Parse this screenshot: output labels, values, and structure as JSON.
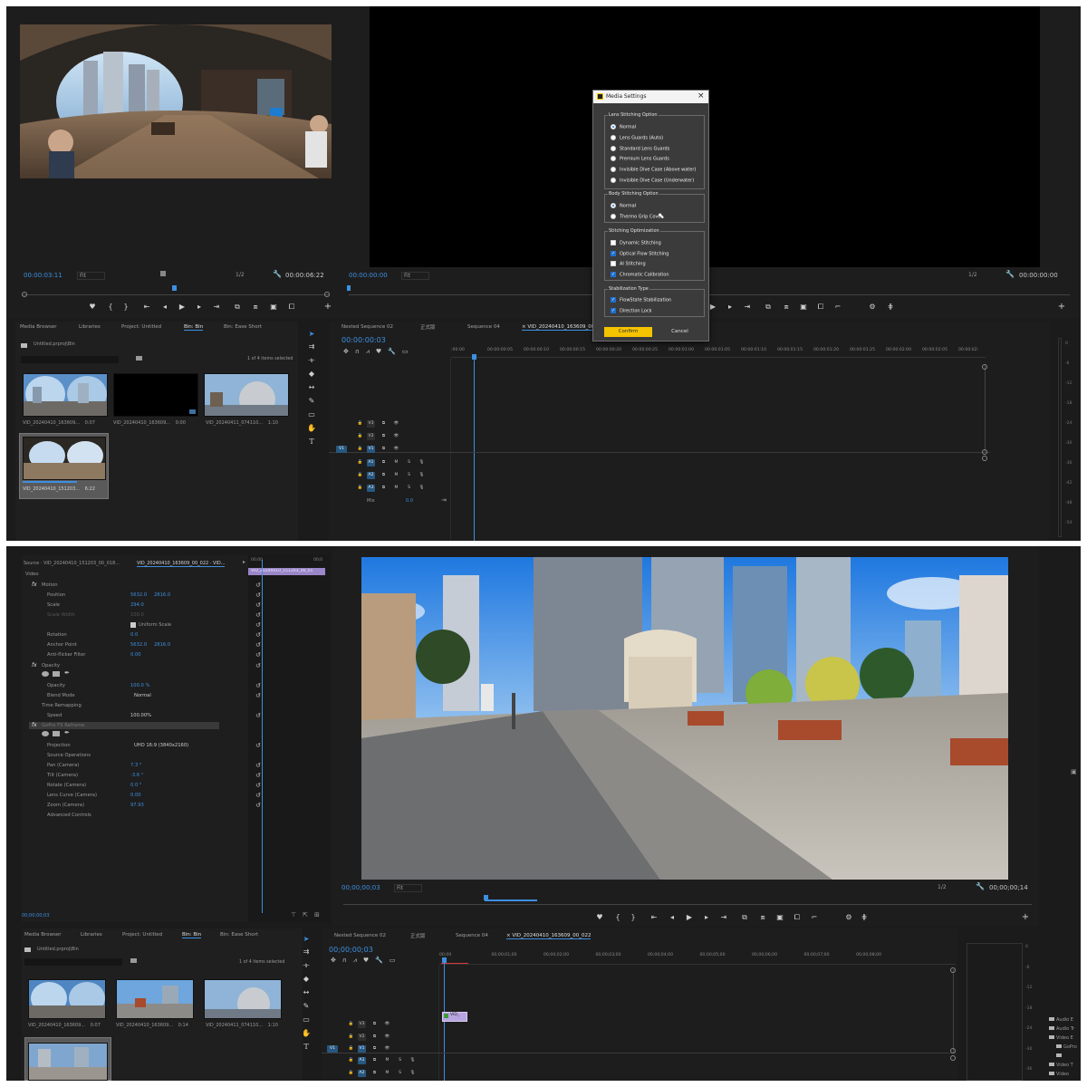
{
  "top": {
    "source_timecode": "00:00:03:11",
    "source_fit": "Fit",
    "source_ratio": "1/2",
    "source_duration": "00:00:06:22",
    "program_timecode": "00:00:00:00",
    "program_fit": "Fit",
    "program_ratio": "1/2",
    "program_duration": "00:00:00:00",
    "project_tabs": [
      "Media Browser",
      "Libraries",
      "Project: Untitled",
      "Bin: Bin",
      "Bin: Ease Short"
    ],
    "project_path": "Untitled.prproj\\Bin",
    "items_selected": "1 of 4 items selected",
    "clips": [
      {
        "name": "VID_20240410_163609...",
        "duration": "0:07"
      },
      {
        "name": "VID_20240410_163609...",
        "duration": "0:00"
      },
      {
        "name": "VID_20240411_074110...",
        "duration": "1:10"
      },
      {
        "name": "VID_20240410_151203...",
        "duration": "6:22"
      }
    ],
    "seq_tabs": [
      "Nested Sequence 02",
      "正式版",
      "Sequence 04",
      "VID_20240410_163609_00_..."
    ],
    "seq_timecode": "00:00:00:03",
    "ruler": [
      ":00:00",
      "00:00:00:05",
      "00:00:00:10",
      "00:00:00:15",
      "00:00:00:20",
      "00:00:00:25",
      "00:00:01:00",
      "00:00:01:05",
      "00:00:01:10",
      "00:00:01:15",
      "00:00:01:20",
      "00:00:01:25",
      "00:00:02:00",
      "00:00:02:05",
      "00:00:02:"
    ],
    "video_tracks": [
      "V3",
      "V2",
      "V1"
    ],
    "audio_tracks": [
      "A1",
      "A2",
      "A3"
    ],
    "mix_label": "Mix",
    "mix_value": "0.0",
    "meter_ticks": [
      "0",
      "-6",
      "-12",
      "-18",
      "-24",
      "-30",
      "-36",
      "-42",
      "-48",
      "-54"
    ]
  },
  "dialog": {
    "title": "Media Settings",
    "close": "×",
    "lens_title": "Lens Stitching Option",
    "lens_options": [
      "Normal",
      "Lens Guards (Auto)",
      "Standard Lens Guards",
      "Premium Lens Guards",
      "Invisible Dive Case (Above water)",
      "Invisible Dive Case (Underwater)"
    ],
    "lens_selected": 0,
    "body_title": "Body Stitching Option",
    "body_options": [
      "Normal",
      "Thermo Grip Cover"
    ],
    "body_selected": 0,
    "opt_title": "Stitching Optimization",
    "opt_options": [
      {
        "label": "Dynamic Stitching",
        "checked": false
      },
      {
        "label": "Optical Flow Stitching",
        "checked": true
      },
      {
        "label": "AI Stitching",
        "checked": false
      },
      {
        "label": "Chromatic Calibration",
        "checked": true
      }
    ],
    "stab_title": "Stabilization Type",
    "stab_options": [
      {
        "label": "FlowState Stabilization",
        "checked": true
      },
      {
        "label": "Direction Lock",
        "checked": true
      }
    ],
    "confirm": "Confirm",
    "cancel": "Cancel",
    "accent": "#f5c400"
  },
  "bottom": {
    "source_label": "Source · VID_20240410_151203_00_018...",
    "seq_label": "VID_20240410_163609_00_022 · VID...",
    "clip_label": "VID_20240410_151203_00_01",
    "video_section": "Video",
    "props": {
      "motion": "Motion",
      "position": "Position",
      "position_x": "5632.0",
      "position_y": "2816.0",
      "scale": "Scale",
      "scale_val": "294.0",
      "scale_width": "Scale Width",
      "scale_width_val": "100.0",
      "uniform": "Uniform Scale",
      "rotation": "Rotation",
      "rotation_val": "0.0",
      "anchor": "Anchor Point",
      "anchor_x": "5632.0",
      "anchor_y": "2816.0",
      "antiflicker": "Anti-flicker Filter",
      "antiflicker_val": "0.00",
      "opacity": "Opacity",
      "opacity_prop": "Opacity",
      "opacity_val": "100.0 %",
      "blend": "Blend Mode",
      "blend_val": "Normal",
      "time_remap": "Time Remapping",
      "speed": "Speed",
      "speed_val": "100.00%",
      "reframe": "GoPro FX Reframe",
      "projection": "Projection",
      "projection_val": "UHD 16:9 (3840x2160)",
      "source_ops": "Source Operations",
      "pan": "Pan (Camera)",
      "pan_val": "7.3 °",
      "tilt": "Tilt (Camera)",
      "tilt_val": "-3.6 °",
      "rotate": "Rotate (Camera)",
      "rotate_val": "0.0 °",
      "lens_curve": "Lens Curve (Camera)",
      "lens_curve_val": "0.00",
      "zoom": "Zoom (Camera)",
      "zoom_val": "97.93",
      "advanced": "Advanced Controls"
    },
    "ec_timecode": "00;00;00;03",
    "program_timecode": "00;00;00;03",
    "program_fit": "Fit",
    "program_ratio": "1/2",
    "program_duration": "00;00;00;14",
    "project_tabs": [
      "Media Browser",
      "Libraries",
      "Project: Untitled",
      "Bin: Bin",
      "Bin: Ease Short"
    ],
    "project_path": "Untitled.prproj\\Bin",
    "items_selected": "1 of 4 items selected",
    "clips": [
      {
        "name": "VID_20240410_163609...",
        "duration": "0:07"
      },
      {
        "name": "VID_20240410_163609...",
        "duration": "0:14"
      },
      {
        "name": "VID_20240411_074110...",
        "duration": "1:10"
      }
    ],
    "seq_tabs": [
      "Nested Sequence 02",
      "正式版",
      "Sequence 04",
      "VID_20240410_163609_00_022"
    ],
    "seq_timecode": "00;00;00;03",
    "ruler": [
      "00;00",
      "00;00;01;00",
      "00;00;02;00",
      "00;00;03;00",
      "00;00;04;00",
      "00;00;05;00",
      "00;00;06;00",
      "00;00;07;00",
      "00;00;08;00"
    ],
    "video_tracks": [
      "V3",
      "V2",
      "V1"
    ],
    "audio_tracks": [
      "A1",
      "A2"
    ],
    "clip_chip": "VID_",
    "meter_ticks": [
      "0",
      "-6",
      "-12",
      "-18",
      "-24",
      "-30",
      "-36"
    ],
    "folders": [
      "Audio E",
      "Audio Tr",
      "Video E",
      "GoPro",
      "",
      "Video T",
      "Video"
    ]
  }
}
